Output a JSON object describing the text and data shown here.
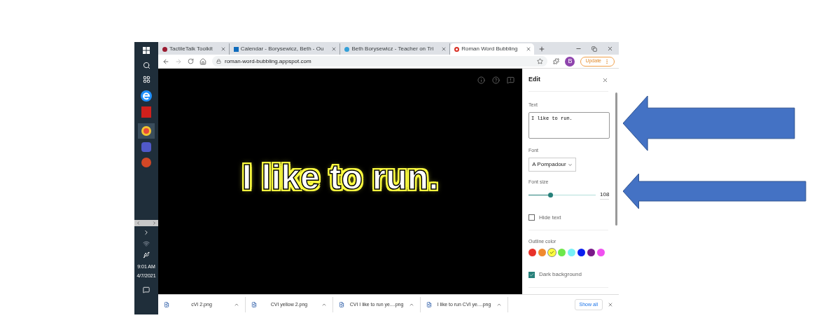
{
  "taskbar": {
    "time": "9:01 AM",
    "date": "4/7/2021"
  },
  "tabs": [
    {
      "title": "TactileTalk Toolkit",
      "selected": false
    },
    {
      "title": "Calendar - Borysewicz, Beth - Ou",
      "selected": false
    },
    {
      "title": "Beth Borysewicz - Teacher on Tri",
      "selected": false
    },
    {
      "title": "Roman Word Bubbling",
      "selected": true
    }
  ],
  "address": "roman-word-bubbling.appspot.com",
  "profile_initial": "B",
  "update_button": "Update",
  "canvas": {
    "text": "I like to run."
  },
  "panel": {
    "title": "Edit",
    "text_label": "Text",
    "text_value": "I like to run.",
    "font_label": "Font",
    "font_value": "A Pompadour",
    "font_size_label": "Font size",
    "font_size_slider": {
      "level": 0.33
    },
    "font_size_value": "108",
    "hide_text": {
      "label": "Hide text",
      "checked": false
    },
    "outline_label": "Outline color",
    "outline_colors": [
      {
        "color": "#e8322a",
        "selected": false
      },
      {
        "color": "#f08a30",
        "selected": false
      },
      {
        "color": "#ffff40",
        "selected": true
      },
      {
        "color": "#6de84a",
        "selected": false
      },
      {
        "color": "#78f0f5",
        "selected": false
      },
      {
        "color": "#0a1ef0",
        "selected": false
      },
      {
        "color": "#7a1a88",
        "selected": false
      },
      {
        "color": "#f050f0",
        "selected": false
      }
    ],
    "dark_background": {
      "label": "Dark background",
      "checked": true
    }
  },
  "downloads": [
    "cVI 2.png",
    "CVI yellow 2.png",
    "CVI I like to run ye....png",
    "I like to run CVI ye....png"
  ],
  "show_all": "Show all"
}
